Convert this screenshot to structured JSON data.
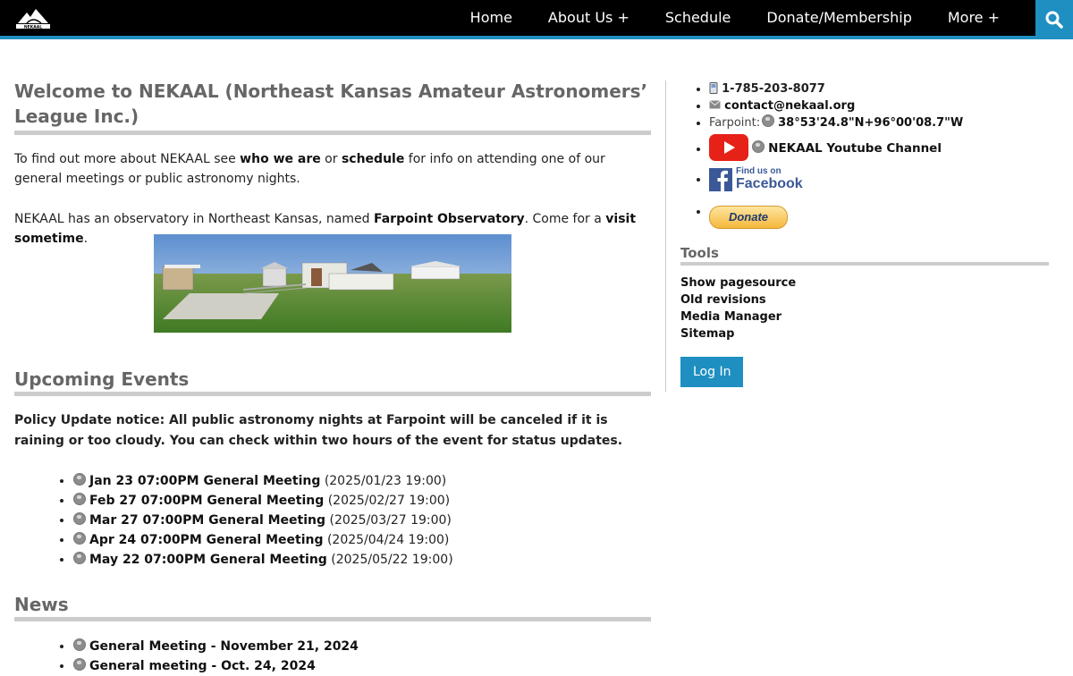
{
  "nav": {
    "logo_text": "NEKAAL",
    "items": [
      "Home",
      "About Us +",
      "Schedule",
      "Donate/Membership",
      "More +"
    ]
  },
  "main": {
    "title": "Welcome to NEKAAL (Northeast Kansas Amateur Astronomers’ League Inc.)",
    "intro": {
      "prefix": "To find out more about NEKAAL see ",
      "link1": "who we are",
      "mid": " or ",
      "link2": "schedule",
      "suffix": " for info on attending one of our general meetings or public astronomy nights."
    },
    "observatory": {
      "prefix": "NEKAAL has an observatory in Northeast Kansas, named ",
      "name": "Farpoint Observatory",
      "mid": ". Come for a ",
      "link": "visit sometime",
      "suffix": "."
    },
    "events_heading": "Upcoming Events",
    "policy": "Policy Update notice: All public astronomy nights at Farpoint will be canceled if it is raining or too cloudy. You can check within two hours of the event for status updates.",
    "events": [
      {
        "title": "Jan 23 07:00PM General Meeting",
        "date": "(2025/01/23 19:00)"
      },
      {
        "title": "Feb 27 07:00PM General Meeting",
        "date": "(2025/02/27 19:00)"
      },
      {
        "title": "Mar 27 07:00PM General Meeting",
        "date": "(2025/03/27 19:00)"
      },
      {
        "title": "Apr 24 07:00PM General Meeting",
        "date": "(2025/04/24 19:00)"
      },
      {
        "title": "May 22 07:00PM General Meeting",
        "date": "(2025/05/22 19:00)"
      }
    ],
    "news_heading": "News",
    "news": [
      "General Meeting - November 21, 2024",
      "General meeting - Oct. 24, 2024"
    ]
  },
  "sidebar": {
    "phone": "1-785-203-8077",
    "email": "contact@nekaal.org",
    "farpoint_label": "Farpoint:",
    "coords": "38°53'24.8\"N+96°00'08.7\"W",
    "youtube": "NEKAAL Youtube Channel",
    "facebook_top": "Find us on",
    "facebook_bottom": "Facebook",
    "donate": "Donate",
    "tools_heading": "Tools",
    "tools": [
      "Show pagesource",
      "Old revisions",
      "Media Manager",
      "Sitemap"
    ],
    "login": "Log In"
  },
  "colors": {
    "accent": "#1e8fc0",
    "nav_bg": "#000000",
    "heading": "#666666",
    "rule": "#cccccc"
  }
}
